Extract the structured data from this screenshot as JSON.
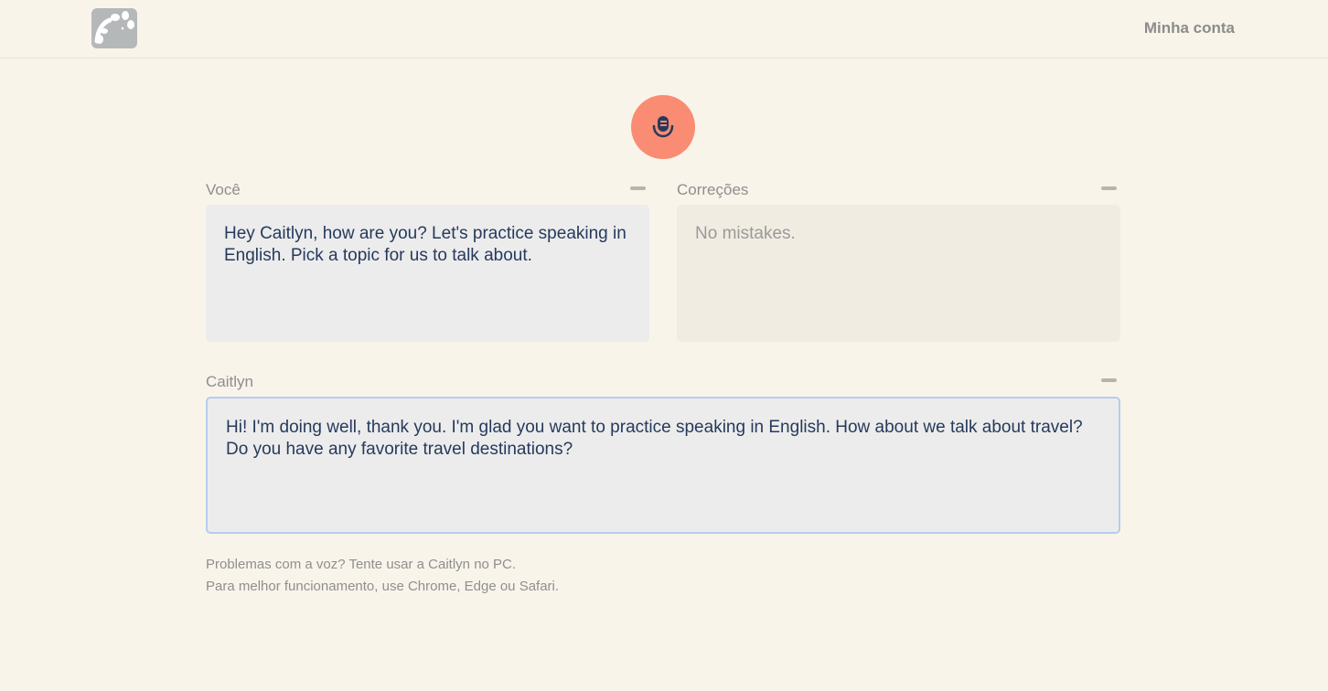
{
  "header": {
    "logo_icon": "sheep-logo-icon",
    "account_link": "Minha conta"
  },
  "controls": {
    "mic_icon": "microphone-icon",
    "mic_color": "#f98c73"
  },
  "panels": {
    "you": {
      "label": "Você",
      "text": "Hey Caitlyn, how are you? Let's practice speaking in English. Pick a topic for us to talk about."
    },
    "corrections": {
      "label": "Correções",
      "text": "No mistakes."
    },
    "assistant": {
      "label": "Caitlyn",
      "text": "Hi! I'm doing well, thank you. I'm glad you want to practice speaking in English. How about we talk about travel? Do you have any favorite travel destinations?"
    }
  },
  "footer": {
    "line1": "Problemas com a voz? Tente usar a Caitlyn no PC.",
    "line2": "Para melhor funcionamento, use Chrome, Edge ou Safari."
  }
}
